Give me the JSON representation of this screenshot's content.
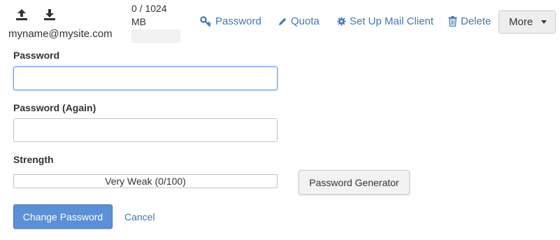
{
  "account": {
    "email": "myname@mysite.com",
    "usage_line1": "0 / 1024",
    "usage_line2": "MB",
    "usage_fraction": 0
  },
  "actions": {
    "password": "Password",
    "quota": "Quota",
    "setup_mail_client": "Set Up Mail Client",
    "delete": "Delete",
    "more": "More"
  },
  "icons": {
    "upload": "upload-icon",
    "download": "download-icon",
    "password": "key-icon",
    "quota": "pencil-icon",
    "setup": "gear-icon",
    "delete": "trash-icon",
    "more": "caret-down-icon"
  },
  "form": {
    "password_label": "Password",
    "password_value": "",
    "password_again_label": "Password (Again)",
    "password_again_value": "",
    "strength_label": "Strength",
    "strength_text": "Very Weak (0/100)",
    "strength_score": 0,
    "generator_button": "Password Generator",
    "submit_button": "Change Password",
    "cancel_link": "Cancel"
  },
  "colors": {
    "link": "#3f79b8",
    "primary_button": "#5b8fd6",
    "focus_border": "#6a97d8"
  }
}
